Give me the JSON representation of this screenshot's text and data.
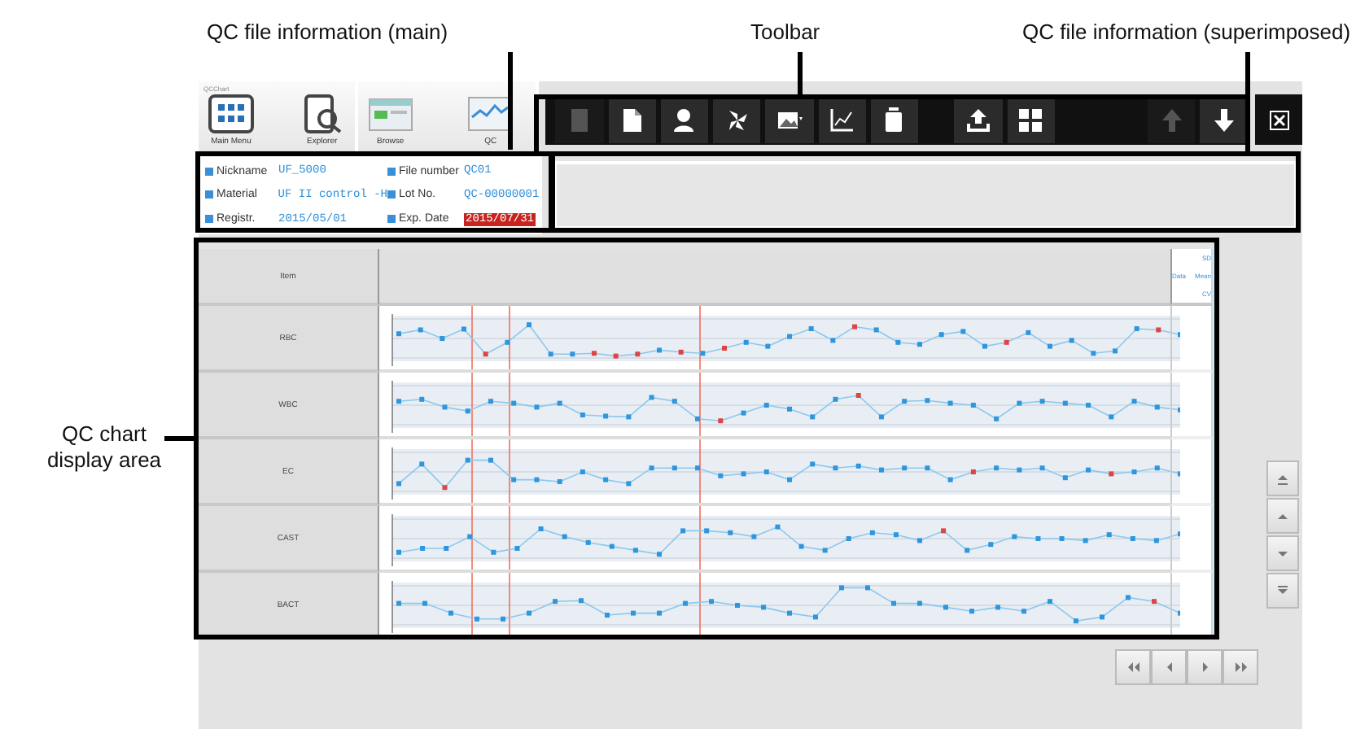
{
  "annotations": [
    {
      "text": "QC file information (main)"
    },
    {
      "text": "Toolbar"
    },
    {
      "text": "QC file information (superimposed)"
    },
    {
      "text": "QC chart display area"
    }
  ],
  "app": {
    "name": "QCChart"
  },
  "nav_buttons": [
    {
      "label": "Main Menu"
    },
    {
      "label": "Explorer"
    },
    {
      "label": "Browse"
    },
    {
      "label": "QC"
    }
  ],
  "toolbar": {
    "buttons": [
      {
        "disabled": true
      },
      {
        "disabled": false
      },
      {
        "disabled": false
      },
      {
        "disabled": false
      },
      {
        "disabled": false
      },
      {
        "disabled": false
      },
      {
        "disabled": false
      },
      {
        "disabled": false
      },
      {
        "disabled": false
      },
      {
        "disabled": true
      },
      {
        "disabled": false
      }
    ]
  },
  "file_info": [
    {
      "label": "Nickname",
      "value": "UF_5000",
      "expired": false
    },
    {
      "label": "File number",
      "value": "QC01",
      "expired": false
    },
    {
      "label": "Material",
      "value": "UF II control -H",
      "expired": false
    },
    {
      "label": "Lot No.",
      "value": "QC-00000001",
      "expired": false
    },
    {
      "label": "Registr.",
      "value": "2015/05/01",
      "expired": false
    },
    {
      "label": "Exp. Date",
      "value": "2015/07/31",
      "expired": true
    }
  ],
  "chart": {
    "item_header": "Item",
    "columns": [
      "SD",
      "Data",
      "Mean",
      "CV"
    ],
    "rows": [
      {
        "item": "RBC"
      },
      {
        "item": "WBC"
      },
      {
        "item": "EC"
      },
      {
        "item": "CAST"
      },
      {
        "item": "BACT"
      }
    ]
  }
}
